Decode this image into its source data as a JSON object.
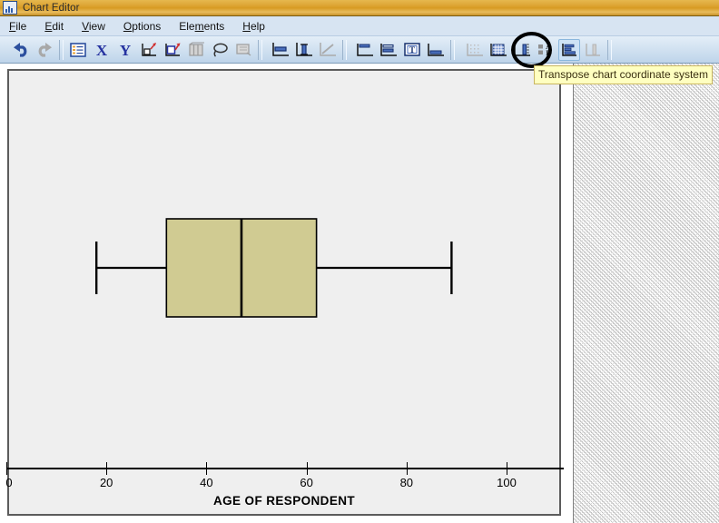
{
  "window": {
    "title": "Chart Editor",
    "icon": "chart-bars-icon"
  },
  "menubar": {
    "items": [
      {
        "label": "File",
        "mnemonic": "F"
      },
      {
        "label": "Edit",
        "mnemonic": "E"
      },
      {
        "label": "View",
        "mnemonic": "V"
      },
      {
        "label": "Options",
        "mnemonic": "O"
      },
      {
        "label": "Elements",
        "mnemonic": "m"
      },
      {
        "label": "Help",
        "mnemonic": "H"
      }
    ]
  },
  "toolbar": {
    "buttons": [
      {
        "name": "undo-icon",
        "enabled": true
      },
      {
        "name": "redo-icon",
        "enabled": false
      },
      {
        "name": "properties-icon",
        "enabled": true
      },
      {
        "name": "x-axis-icon",
        "enabled": true
      },
      {
        "name": "y-axis-icon",
        "enabled": true
      },
      {
        "name": "add-fit-line-icon",
        "enabled": true
      },
      {
        "name": "add-reference-line-icon",
        "enabled": true
      },
      {
        "name": "three-d-rotation-icon",
        "enabled": false
      },
      {
        "name": "lasso-select-icon",
        "enabled": true
      },
      {
        "name": "data-label-mode-icon",
        "enabled": false
      },
      {
        "name": "bar-style-icon",
        "enabled": true
      },
      {
        "name": "error-bar-icon",
        "enabled": true
      },
      {
        "name": "line-style-icon",
        "enabled": false
      },
      {
        "name": "top-axis-icon",
        "enabled": true
      },
      {
        "name": "stacked-bar-icon",
        "enabled": true
      },
      {
        "name": "text-box-icon",
        "enabled": true
      },
      {
        "name": "footnote-icon",
        "enabled": true
      },
      {
        "name": "hide-grid-icon",
        "enabled": false
      },
      {
        "name": "show-grid-icon",
        "enabled": true
      },
      {
        "name": "axis-scale-icon",
        "enabled": true
      },
      {
        "name": "sort-categories-icon",
        "enabled": true
      },
      {
        "name": "transpose-chart-icon",
        "enabled": true,
        "active": true
      },
      {
        "name": "swap-axes-icon",
        "enabled": false
      }
    ],
    "tooltip": "Transpose chart coordinate system",
    "highlighted_button": "transpose-chart-icon"
  },
  "chart_data": {
    "type": "box",
    "title": "",
    "xlabel": "AGE OF RESPONDENT",
    "ylabel": "",
    "orientation": "horizontal",
    "xlim": [
      0,
      111
    ],
    "xticks": [
      0,
      20,
      40,
      60,
      80,
      100
    ],
    "xticklabels": [
      "0",
      "20",
      "40",
      "60",
      "80",
      "100"
    ],
    "grid": false,
    "legend": null,
    "boxes": [
      {
        "label": "AGE OF RESPONDENT",
        "whisker_low": 18,
        "q1": 32,
        "median": 47,
        "q3": 62,
        "whisker_high": 89,
        "outliers": [],
        "fill_color": "#d0cb92",
        "line_color": "#000000"
      }
    ],
    "plot_background": "#efefef"
  },
  "colors": {
    "titlebar": "#d79b22",
    "menubar": "#d7e4f2",
    "toolbar": "#cfe0f0",
    "tooltip_bg": "#ffffc0",
    "box_fill": "#d0cb92",
    "plot_bg": "#efefef",
    "annotation_circle": "#000000"
  }
}
